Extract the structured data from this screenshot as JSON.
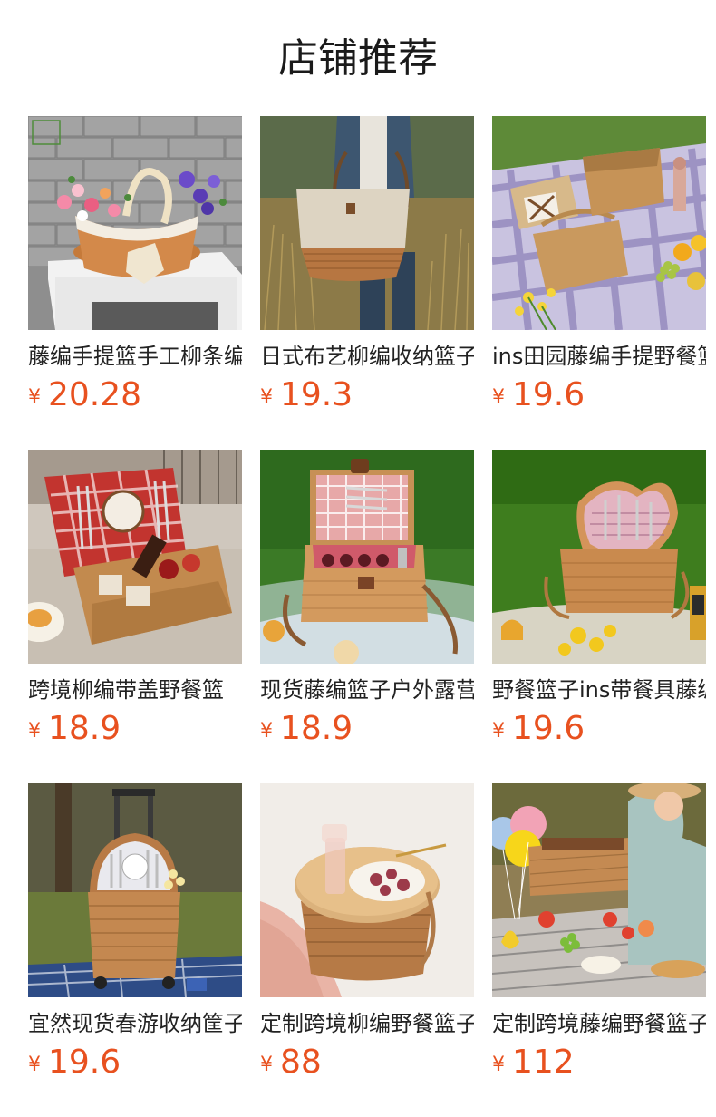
{
  "header": {
    "title": "店铺推荐"
  },
  "colors": {
    "price": "#e8511f",
    "title": "#1a1a1a"
  },
  "products": [
    {
      "name": "藤编手提篮手工柳条编织",
      "currency": "¥",
      "price": "20.28",
      "image": "flower-basket-image"
    },
    {
      "name": "日式布艺柳编收纳篮子",
      "currency": "¥",
      "price": "19.3",
      "image": "canvas-wicker-tote-image"
    },
    {
      "name": "ins田园藤编手提野餐篮",
      "currency": "¥",
      "price": "19.6",
      "image": "picnic-baskets-on-gingham-image"
    },
    {
      "name": "跨境柳编带盖野餐篮",
      "currency": "¥",
      "price": "18.9",
      "image": "open-picnic-hamper-image"
    },
    {
      "name": "现货藤编篮子户外露营",
      "currency": "¥",
      "price": "18.9",
      "image": "red-gingham-hamper-image"
    },
    {
      "name": "野餐篮子ins带餐具藤编",
      "currency": "¥",
      "price": "19.6",
      "image": "heart-picnic-basket-image"
    },
    {
      "name": "宜然现货春游收纳筐子",
      "currency": "¥",
      "price": "19.6",
      "image": "trolley-picnic-basket-image"
    },
    {
      "name": "定制跨境柳编野餐篮子",
      "currency": "¥",
      "price": "88",
      "image": "round-wood-lid-basket-image"
    },
    {
      "name": "定制跨境藤编野餐篮子",
      "currency": "¥",
      "price": "112",
      "image": "picnic-scene-image"
    }
  ]
}
